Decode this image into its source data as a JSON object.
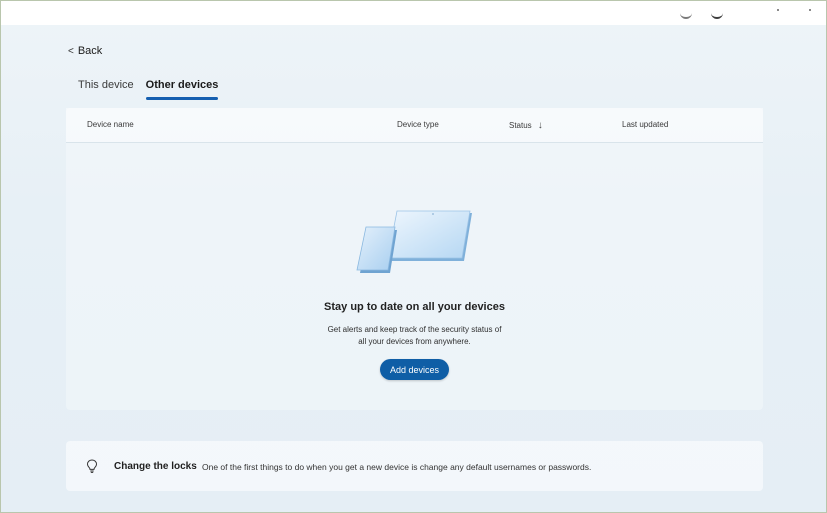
{
  "nav": {
    "back_label": "Back"
  },
  "tabs": [
    {
      "label": "This device",
      "active": false
    },
    {
      "label": "Other devices",
      "active": true
    }
  ],
  "devices_table": {
    "columns": [
      "Device name",
      "Device type",
      "Status",
      "Last updated"
    ],
    "sorted_column": "Status",
    "sort_direction": "descending",
    "rows": []
  },
  "empty_state": {
    "title": "Stay up to date on all your devices",
    "description_line1": "Get alerts and keep track of the security status of",
    "description_line2": "all your devices from anywhere.",
    "add_button_label": "Add devices"
  },
  "tip": {
    "icon": "lightbulb-icon",
    "title": "Change the locks",
    "text": "One of the first things to do when you get a new device is change any default usernames or passwords."
  },
  "colors": {
    "accent": "#0f5ea6",
    "tab_indicator": "#155fb0",
    "background": "#e7f0f6"
  }
}
